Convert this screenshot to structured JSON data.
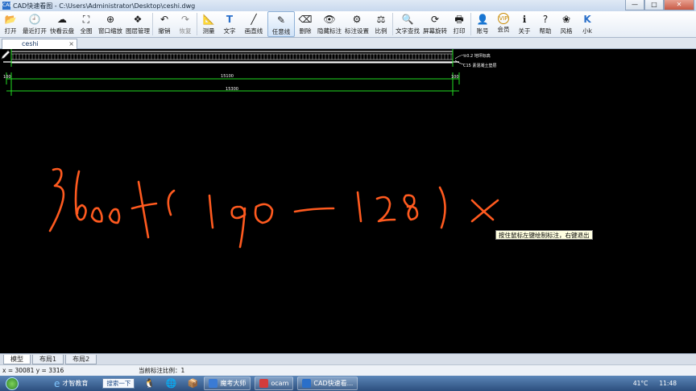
{
  "window": {
    "title": "CAD快速看图 - C:\\Users\\Administrator\\Desktop\\ceshi.dwg",
    "app_icon_text": "CAD",
    "controls": {
      "minimize": "—",
      "maximize": "□",
      "close": "✕"
    }
  },
  "toolbar": {
    "items": [
      {
        "id": "open",
        "label": "打开",
        "icon": "folder-icon",
        "glyph": "📂"
      },
      {
        "id": "recent",
        "label": "最近打开",
        "icon": "clock-icon",
        "glyph": "🕘"
      },
      {
        "id": "cloud",
        "label": "快看云盘",
        "icon": "cloud-icon",
        "glyph": "☁"
      },
      {
        "id": "fullview",
        "label": "全图",
        "icon": "fullview-icon",
        "glyph": "⛶"
      },
      {
        "id": "zoom-window",
        "label": "窗口缩放",
        "icon": "zoom-window-icon",
        "glyph": "⊕"
      },
      {
        "id": "layers",
        "label": "图层管理",
        "icon": "layers-icon",
        "glyph": "❖"
      },
      {
        "id": "undo",
        "label": "撤销",
        "icon": "undo-icon",
        "glyph": "↶"
      },
      {
        "id": "redo",
        "label": "恢复",
        "icon": "redo-icon",
        "glyph": "↷",
        "disabled": true
      },
      {
        "id": "measure",
        "label": "测量",
        "icon": "measure-icon",
        "glyph": "📐"
      },
      {
        "id": "text",
        "label": "文字",
        "icon": "text-icon",
        "glyph": "T"
      },
      {
        "id": "line",
        "label": "画直线",
        "icon": "line-icon",
        "glyph": "╱"
      },
      {
        "id": "freehand",
        "label": "任意线",
        "icon": "pen-icon",
        "glyph": "✎",
        "active": true
      },
      {
        "id": "delete",
        "label": "删除",
        "icon": "eraser-icon",
        "glyph": "⌫"
      },
      {
        "id": "hide-annot",
        "label": "隐藏标注",
        "icon": "eye-icon",
        "glyph": "👁"
      },
      {
        "id": "annot-settings",
        "label": "标注设置",
        "icon": "annotation-settings-icon",
        "glyph": "⚙"
      },
      {
        "id": "ratio",
        "label": "比例",
        "icon": "ratio-icon",
        "glyph": "⚖"
      },
      {
        "id": "text-search",
        "label": "文字查找",
        "icon": "text-search-icon",
        "glyph": "🔍"
      },
      {
        "id": "rotate",
        "label": "屏幕旋转",
        "icon": "rotate-icon",
        "glyph": "⟳"
      },
      {
        "id": "print",
        "label": "打印",
        "icon": "printer-icon",
        "glyph": "🖶"
      },
      {
        "id": "account",
        "label": "账号",
        "icon": "account-icon",
        "glyph": "👤"
      },
      {
        "id": "vip",
        "label": "会员",
        "icon": "vip-icon",
        "glyph": "VIP"
      },
      {
        "id": "about",
        "label": "关于",
        "icon": "info-icon",
        "glyph": "ℹ"
      },
      {
        "id": "help",
        "label": "帮助",
        "icon": "help-icon",
        "glyph": "?"
      },
      {
        "id": "style",
        "label": "风格",
        "icon": "style-icon",
        "glyph": "❀"
      },
      {
        "id": "small-k",
        "label": "小k",
        "icon": "k-icon",
        "glyph": "K"
      }
    ]
  },
  "document_tab": {
    "label": "ceshi",
    "close": "×"
  },
  "drawing": {
    "dim_overall_top": "15100",
    "dim_overall_bottom": "15300",
    "dim_left": "100",
    "dim_right": "100",
    "elev_label_1": "±0.2 地坪标高",
    "elev_label_2": "C15 素混凝土垫层",
    "handwriting": "3600+(190-128)×",
    "colors": {
      "background": "#000000",
      "dimension": "#22dd22",
      "structure": "#ffffff",
      "ink": "#ff5a1f"
    }
  },
  "tooltip": "按住鼠标左键绘制标注，右键退出",
  "layout_tabs": [
    "模型",
    "布局1",
    "布局2"
  ],
  "status": {
    "coords": "x = 30081  y = 3316",
    "scale": "当前标注比例：1"
  },
  "taskbar": {
    "ie_label": "才智教育",
    "search_label": "搜索一下",
    "tasks": [
      {
        "label": "魔考大师",
        "color": "#3a7bd5"
      },
      {
        "label": "ocam",
        "color": "#d23c3c"
      },
      {
        "label": "CAD快速看...",
        "color": "#2a6fc9"
      }
    ],
    "weather_temp": "41°C",
    "weather_desc": "",
    "clock_time": "11:48",
    "clock_date": ""
  }
}
